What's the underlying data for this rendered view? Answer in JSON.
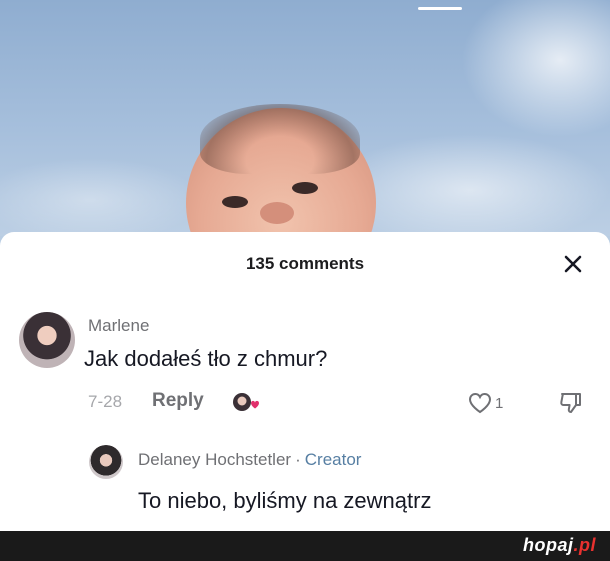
{
  "video": {
    "drag_handle_color": "#ffffff"
  },
  "comments_panel": {
    "count_label": "135 comments",
    "close_icon": "close-icon",
    "comments": [
      {
        "username": "Marlene",
        "text": "Jak dodałeś tło z chmur?",
        "date": "7-28",
        "reply_label": "Reply",
        "creator_liked_icon": "creator-liked-icon",
        "like_count": "1",
        "replies": [
          {
            "username": "Delaney Hochstetler",
            "separator": "·",
            "badge": "Creator",
            "text": "To niebo, byliśmy na zewnątrz"
          }
        ]
      }
    ]
  },
  "site_bar": {
    "logo_name": "hopaj",
    "logo_tld": ".pl"
  },
  "colors": {
    "text_primary": "#161823",
    "text_secondary": "#6f7074",
    "creator_badge": "#577fa3",
    "like_heart": "#e1306c",
    "site_bar_bg": "#1a1a1a",
    "logo_accent": "#e8312f"
  }
}
